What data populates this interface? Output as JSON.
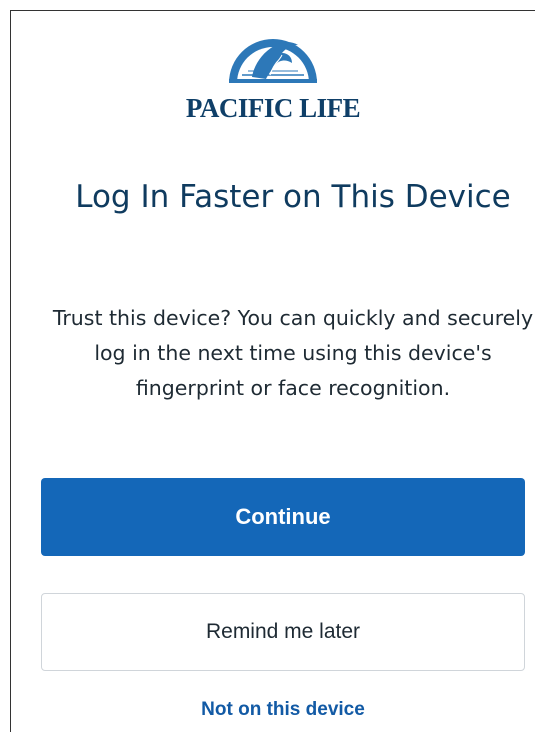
{
  "brand": {
    "name": "PACIFIC LIFE",
    "logo_icon": "whale-icon",
    "color": "#0f3f68"
  },
  "page": {
    "title": "Log In Faster on This Device",
    "message": "Trust this device? You can quickly and securely log in the next time using this device's fingerprint or face recognition."
  },
  "actions": {
    "continue_label": "Continue",
    "remind_label": "Remind me later",
    "not_device_label": "Not on this device"
  },
  "colors": {
    "primary": "#1467b8",
    "link": "#125aa5",
    "title": "#0f3b5f"
  }
}
